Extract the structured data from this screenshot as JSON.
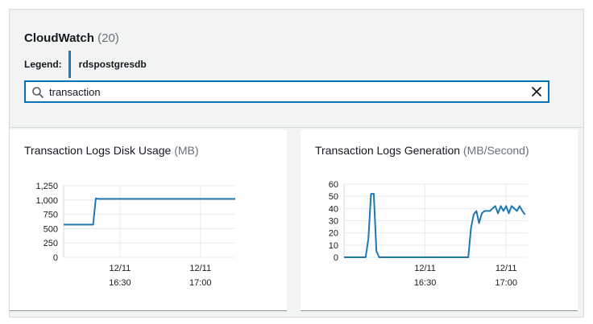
{
  "header": {
    "title": "CloudWatch",
    "count": "(20)",
    "legend_label": "Legend:",
    "legend_item": "rdspostgresdb",
    "legend_color": "#1f77b4"
  },
  "search": {
    "value": "transaction",
    "placeholder": ""
  },
  "colors": {
    "accent": "#0073bb",
    "series": "#1f77b4"
  },
  "chart_data": [
    {
      "type": "line",
      "title": "Transaction Logs Disk Usage",
      "unit": "(MB)",
      "yticks": [
        "1,250",
        "1,000",
        "750",
        "500",
        "250",
        "0"
      ],
      "ylim": [
        0,
        1250
      ],
      "xticks": [
        {
          "date": "12/11",
          "time": "16:30"
        },
        {
          "date": "12/11",
          "time": "17:00"
        }
      ],
      "xlim": [
        "16:09",
        "17:13"
      ],
      "grid": true,
      "series": [
        {
          "x": [
            "16:09",
            "16:20",
            "16:21",
            "16:22",
            "16:30",
            "16:45",
            "17:00",
            "17:13"
          ],
          "values": [
            570,
            570,
            1030,
            1020,
            1020,
            1020,
            1020,
            1020
          ]
        }
      ]
    },
    {
      "type": "line",
      "title": "Transaction Logs Generation",
      "unit": "(MB/Second)",
      "yticks": [
        "60",
        "50",
        "40",
        "30",
        "20",
        "10",
        "0"
      ],
      "ylim": [
        0,
        60
      ],
      "xticks": [
        {
          "date": "12/11",
          "time": "16:30"
        },
        {
          "date": "12/11",
          "time": "17:00"
        }
      ],
      "xlim": [
        "16:00",
        "17:08"
      ],
      "grid": true,
      "series": [
        {
          "x": [
            "16:00",
            "16:04",
            "16:08",
            "16:09",
            "16:10",
            "16:11",
            "16:12",
            "16:13",
            "16:14",
            "16:15",
            "16:16",
            "16:20",
            "16:30",
            "16:40",
            "16:44",
            "16:46",
            "16:47",
            "16:48",
            "16:49",
            "16:50",
            "16:51",
            "16:52",
            "16:53",
            "16:54",
            "16:55",
            "16:56",
            "16:57",
            "16:58",
            "16:59",
            "17:00",
            "17:01",
            "17:02",
            "17:03",
            "17:04",
            "17:05",
            "17:06",
            "17:07"
          ],
          "values": [
            0,
            0,
            0,
            15,
            52,
            52,
            5,
            0,
            0,
            0,
            0,
            0,
            0,
            0,
            0,
            0,
            24,
            35,
            38,
            28,
            36,
            38,
            38,
            38,
            40,
            42,
            36,
            42,
            38,
            42,
            36,
            42,
            40,
            38,
            42,
            38,
            35
          ]
        }
      ]
    }
  ]
}
